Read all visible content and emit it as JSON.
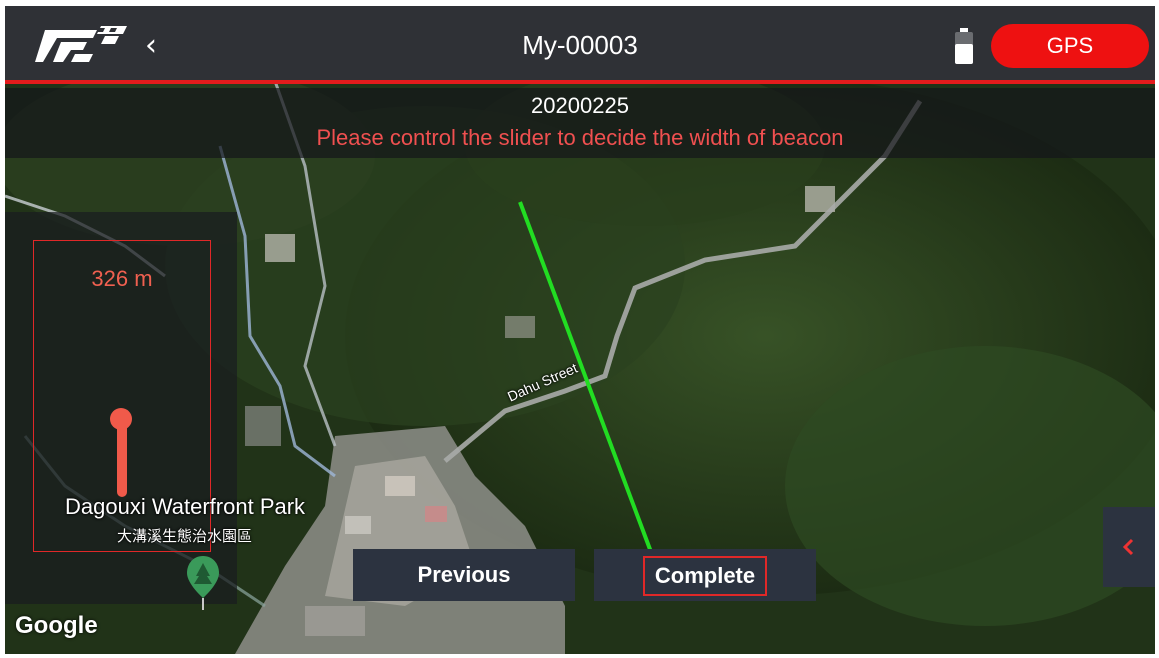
{
  "header": {
    "title": "My-00003",
    "gps_label": "GPS",
    "back_icon": "chevron-left-icon",
    "logo": "brand-logo",
    "battery_icon": "battery-icon"
  },
  "info": {
    "date": "20200225",
    "hint": "Please control the slider to decide the width of beacon"
  },
  "slider": {
    "distance_label": "326 m",
    "level_fraction": 0.38
  },
  "map": {
    "park_name": "Dagouxi Waterfront Park",
    "park_name_cn": "大溝溪生態治水園區",
    "street_name": "Dahu Street",
    "attribution": "Google",
    "pin_icon": "park-pin-icon"
  },
  "actions": {
    "previous_label": "Previous",
    "complete_label": "Complete",
    "drawer_icon": "chevron-left-icon"
  },
  "colors": {
    "accent": "#ee1111",
    "hint": "#f05050",
    "slider": "#f05a4a",
    "beacon_line": "#22dd22",
    "panel": "#2c3340"
  }
}
